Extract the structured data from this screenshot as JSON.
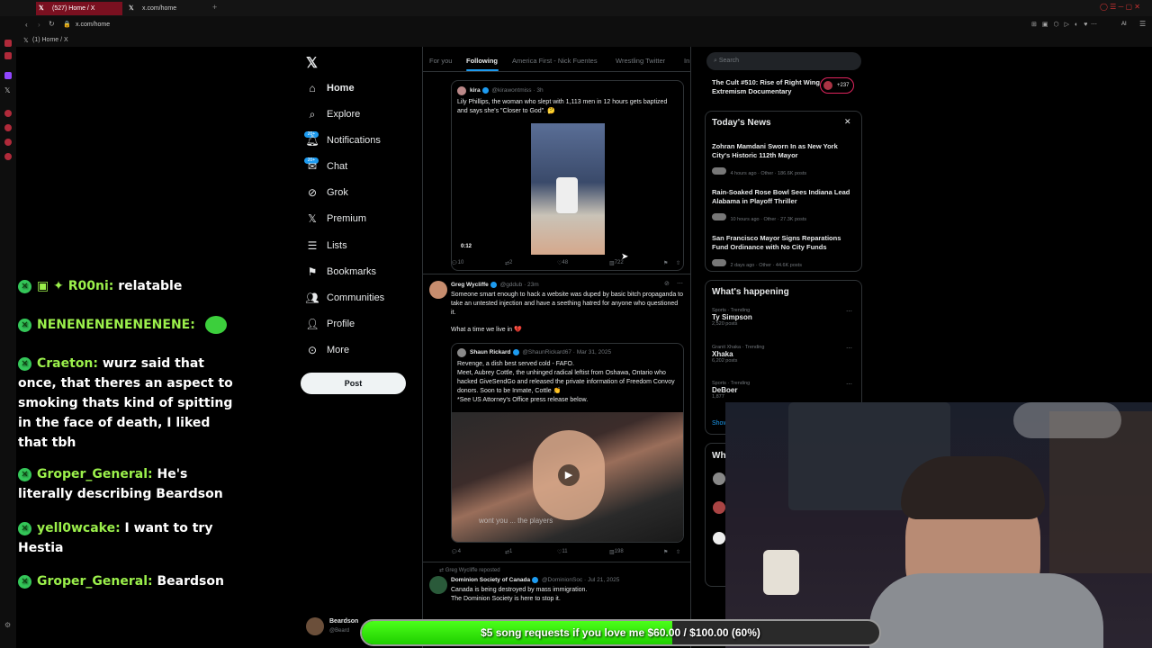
{
  "browser": {
    "tabs": [
      {
        "label": "(527) Home / X",
        "active": true
      },
      {
        "label": "x.com/home",
        "active": false
      }
    ],
    "address": "x.com/home",
    "bookmark": "(1) Home / X",
    "ai_label": "AI"
  },
  "sidebar": {
    "items": [
      {
        "label": "Home",
        "icon": "home-icon",
        "bold": true
      },
      {
        "label": "Explore",
        "icon": "search-icon"
      },
      {
        "label": "Notifications",
        "icon": "bell-icon",
        "badge": "20+"
      },
      {
        "label": "Chat",
        "icon": "mail-icon",
        "badge": "20+"
      },
      {
        "label": "Grok",
        "icon": "grok-icon"
      },
      {
        "label": "Premium",
        "icon": "x-icon"
      },
      {
        "label": "Lists",
        "icon": "list-icon"
      },
      {
        "label": "Bookmarks",
        "icon": "bookmark-icon"
      },
      {
        "label": "Communities",
        "icon": "people-icon"
      },
      {
        "label": "Profile",
        "icon": "person-icon"
      },
      {
        "label": "More",
        "icon": "more-icon"
      }
    ],
    "post_label": "Post",
    "account_name": "Beardson",
    "account_handle": "@Beard"
  },
  "feed": {
    "tabs": [
      "For you",
      "Following",
      "America First - Nick Fuentes",
      "Wrestling Twitter",
      "In"
    ],
    "tweet1": {
      "name": "kira",
      "handle": "@kirawontmiss · 3h",
      "text": "Lily Phillips, the woman who slept with 1,113 men in 12 hours gets baptized and says she's \"Closer to God\". 🤔",
      "video_time": "0:12",
      "replies": "10",
      "reposts": "2",
      "likes": "48",
      "views": "722"
    },
    "tweet2": {
      "name": "Greg Wycliffe",
      "handle": "@gddub · 23m",
      "text": "Someone smart enough to hack a website was duped by basic bitch propaganda to take an untested injection and have a seething hatred for anyone who questioned it.",
      "text2": "What a time we live in 💔",
      "quote_name": "Shaun Rickard",
      "quote_handle": "@ShaunRickard67 · Mar 31, 2025",
      "quote_text": "Revenge, a dish best served cold - FAFO.\nMeet, Aubrey Cottle, the unhinged radical leftist from Oshawa, Ontario who hacked GiveSendGo and released the private information of Freedom Convoy donors. Soon to be Inmate, Cottle 👏\n*See US Attorney's Office press release below.",
      "video_caption": "wont you ... the players",
      "replies": "4",
      "reposts": "1",
      "likes": "11",
      "views": "198"
    },
    "tweet3": {
      "repost_note": "Greg Wycliffe reposted",
      "name": "Dominion Society of Canada",
      "handle": "@DominionSoc · Jul 21, 2025",
      "text": "Canada is being destroyed by mass immigration.\nThe Dominion Society is here to stop it."
    }
  },
  "right": {
    "search_placeholder": "Search",
    "top_item": "The Cult #510: Rise of Right Wing Extremism Documentary",
    "top_count": "+237",
    "todays_news_title": "Today's News",
    "news": [
      {
        "title": "Zohran Mamdani Sworn In as New York City's Historic 112th Mayor",
        "meta": "4 hours ago · Other · 186.6K posts"
      },
      {
        "title": "Rain-Soaked Rose Bowl Sees Indiana Lead Alabama in Playoff Thriller",
        "meta": "10 hours ago · Other · 27.3K posts"
      },
      {
        "title": "San Francisco Mayor Signs Reparations Fund Ordinance with No City Funds",
        "meta": "2 days ago · Other · 44.6K posts"
      }
    ],
    "happening_title": "What's happening",
    "trends": [
      {
        "context": "Sports · Trending",
        "name": "Ty Simpson",
        "posts": "2,520 posts"
      },
      {
        "context": "Granit Xhaka · Trending",
        "name": "Xhaka",
        "posts": "6,202 posts"
      },
      {
        "context": "Sports · Trending",
        "name": "DeBoer",
        "posts": "1,877"
      }
    ],
    "show_more": "Show",
    "who_title": "Wh"
  },
  "chat": [
    {
      "user": "R00ni:",
      "text": "relatable",
      "prefix": "▣ ✦"
    },
    {
      "user": "NENENENENENENENE:",
      "text": ""
    },
    {
      "user": "Craeton:",
      "text": "wurz said that once, that theres an aspect to smoking thats kind of spitting in the face of death, I liked that tbh"
    },
    {
      "user": "Groper_General:",
      "text": "He's literally describing Beardson"
    },
    {
      "user": "yell0wcake:",
      "text": "I want to try Hestia"
    },
    {
      "user": "Groper_General:",
      "text": "Beardson"
    }
  ],
  "song_bar": {
    "text": "$5 song requests if you love me $60.00 / $100.00 (60%)",
    "progress": 0.6
  },
  "colors": {
    "accent": "#1d9bf0",
    "chat_user": "#9bf04b",
    "progress_fill": "#2fe00a"
  }
}
